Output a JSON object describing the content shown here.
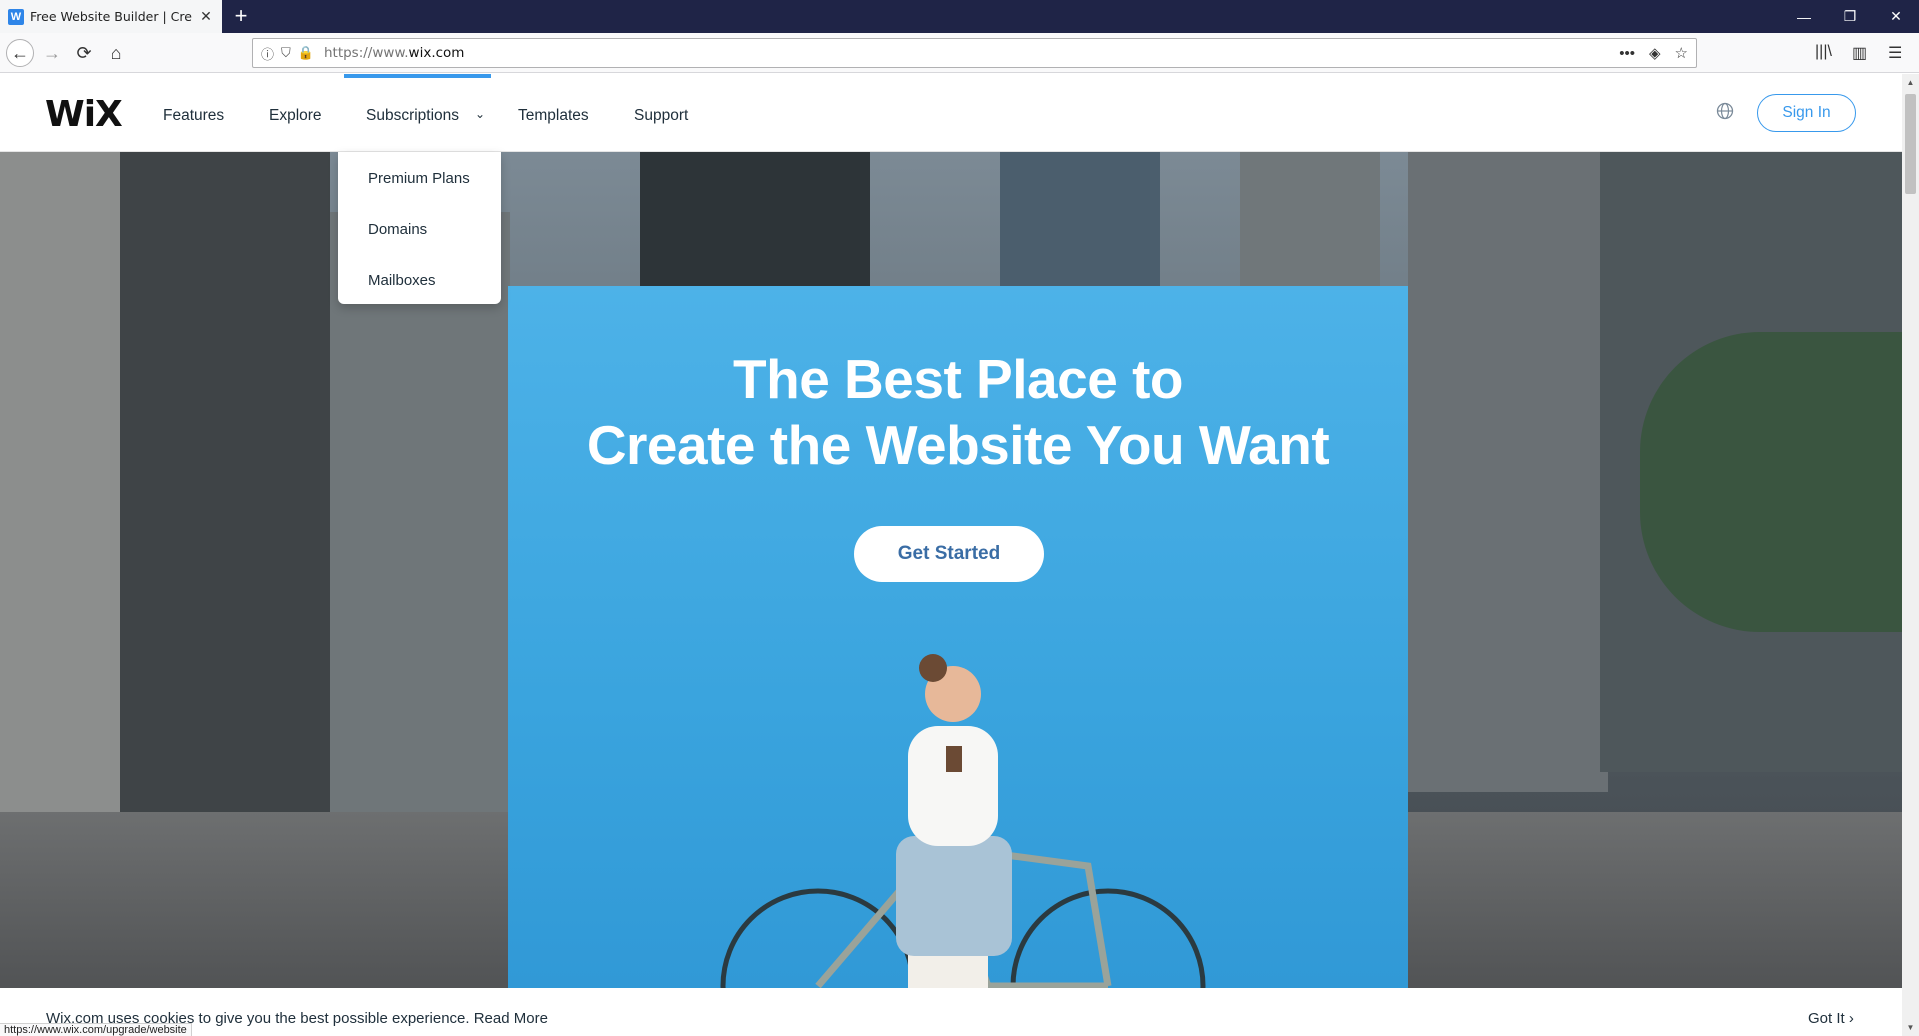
{
  "browser": {
    "tab_title": "Free Website Builder | Create a Free Website",
    "tab_favicon": "W",
    "new_tab": "+",
    "url_prefix": "https://www.",
    "url_domain": "wix.com",
    "status_url": "https://www.wix.com/upgrade/website",
    "icons": {
      "back": "←",
      "forward": "→",
      "reload": "⟳",
      "home": "⌂",
      "info": "ⓘ",
      "shield": "⛉",
      "lock": "🔒",
      "more": "•••",
      "pocket": "◈",
      "bookmark": "☆",
      "library": "|||\\",
      "sidebar": "▥",
      "menu": "☰",
      "minimize": "—",
      "restore": "❐",
      "close": "✕"
    }
  },
  "site": {
    "logo": "WiX",
    "nav": {
      "features": "Features",
      "explore": "Explore",
      "subscriptions": "Subscriptions",
      "templates": "Templates",
      "support": "Support"
    },
    "chevron": "⌄",
    "globe": "🌐",
    "sign_in": "Sign In",
    "dropdown": {
      "premium_plans": "Premium Plans",
      "domains": "Domains",
      "mailboxes": "Mailboxes"
    },
    "hero": {
      "line1": "The Best Place to",
      "line2": "Create the Website You Want",
      "cta": "Get Started"
    },
    "cookie": {
      "text": "Wix.com uses cookies to give you the best possible experience. Read More",
      "got_it": "Got It ›"
    },
    "colors": {
      "accent": "#3899ec",
      "hero_blue": "#3aa4de",
      "titlebar": "#1f2447"
    }
  }
}
